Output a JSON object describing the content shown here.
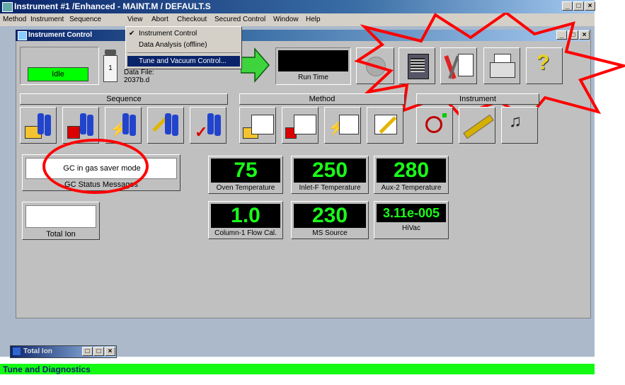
{
  "window": {
    "title": "Instrument #1 /Enhanced - MAINT.M / DEFAULT.S",
    "min_label": "_",
    "max_label": "□",
    "close_label": "×"
  },
  "menubar": {
    "items": [
      "Method",
      "Instrument",
      "Sequence",
      "View",
      "Abort",
      "Checkout",
      "Secured Control",
      "Window",
      "Help"
    ]
  },
  "view_menu": {
    "items": [
      {
        "label": "Instrument Control",
        "checked": true
      },
      {
        "label": "Data Analysis (offline)",
        "checked": false
      },
      {
        "label": "Tune and Vacuum Control...",
        "selected": true
      }
    ],
    "check_mark": "✔"
  },
  "child_window": {
    "title": "Instrument Control"
  },
  "status": {
    "idle_label": "Idle",
    "vial_number": "1",
    "data_file_label": "Data File:",
    "data_file_value": "2037b.d",
    "run_time_label": "Run Time"
  },
  "sections": {
    "sequence": "Sequence",
    "method": "Method",
    "instrument": "Instrument"
  },
  "messages": {
    "gc_message": "GC in gas saver mode",
    "gc_caption": "GC Status Messages",
    "total_ion": "Total Ion"
  },
  "readings": [
    {
      "value": "75",
      "label": "Oven Temperature"
    },
    {
      "value": "250",
      "label": "Inlet-F Temperature"
    },
    {
      "value": "280",
      "label": "Aux-2 Temperature"
    },
    {
      "value": "1.0",
      "label": "Column-1 Flow Cal."
    },
    {
      "value": "230",
      "label": "MS Source"
    },
    {
      "value": "3.11e-005",
      "label": "HiVac"
    }
  ],
  "minimized": {
    "title": "Total Ion"
  },
  "statusbar": {
    "text": "Tune and Diagnostics"
  },
  "colors": {
    "lcd_green": "#19ff19",
    "idle_green": "#00ff00",
    "highlight_red": "#ff0000",
    "status_green": "#13fb13"
  }
}
